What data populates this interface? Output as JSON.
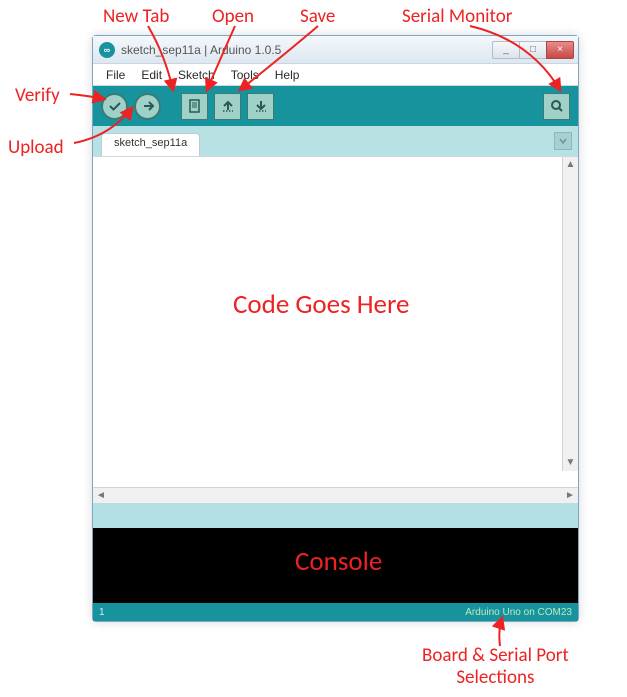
{
  "window": {
    "title": "sketch_sep11a | Arduino 1.0.5",
    "controls": {
      "min": "_",
      "max": "□",
      "close": "×"
    }
  },
  "menu": {
    "items": [
      "File",
      "Edit",
      "Sketch",
      "Tools",
      "Help"
    ]
  },
  "toolbar": {
    "verify": "Verify",
    "upload": "Upload",
    "new": "New",
    "open": "Open",
    "save": "Save",
    "serial": "Serial Monitor"
  },
  "tabs": {
    "items": [
      "sketch_sep11a"
    ]
  },
  "footer": {
    "line": "1",
    "board": "Arduino Uno on COM23"
  },
  "annotations": {
    "new_tab": "New Tab",
    "open": "Open",
    "save": "Save",
    "serial_monitor": "Serial Monitor",
    "verify": "Verify",
    "upload": "Upload",
    "code_here": "Code Goes Here",
    "console": "Console",
    "board_serial_line1": "Board & Serial Port",
    "board_serial_line2": "Selections"
  }
}
